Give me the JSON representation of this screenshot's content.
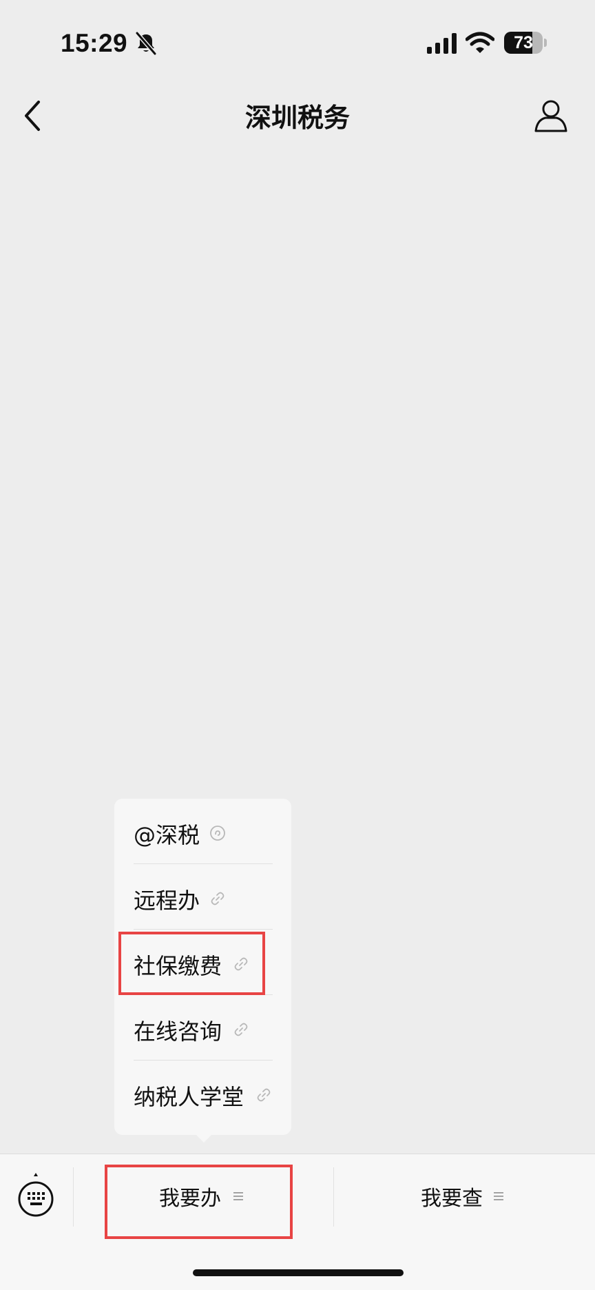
{
  "status_bar": {
    "time": "15:29",
    "battery_level": "73",
    "battery_fraction": 0.73,
    "icons": [
      "mute-bell-icon",
      "cellular-signal-icon",
      "wifi-icon",
      "battery-icon"
    ]
  },
  "nav": {
    "title": "深圳税务",
    "back_icon": "chevron-left-icon",
    "profile_icon": "person-icon"
  },
  "popup_menu": {
    "items": [
      {
        "label": "@深税",
        "icon": "mini-program-icon"
      },
      {
        "label": "远程办",
        "icon": "link-icon"
      },
      {
        "label": "社保缴费",
        "icon": "link-icon"
      },
      {
        "label": "在线咨询",
        "icon": "link-icon"
      },
      {
        "label": "纳税人学堂",
        "icon": "link-icon"
      }
    ]
  },
  "bottom_bar": {
    "keyboard_icon": "keyboard-icon",
    "menus": [
      {
        "label": "我要办",
        "icon": "menu-lines-icon"
      },
      {
        "label": "我要查",
        "icon": "menu-lines-icon"
      }
    ]
  },
  "colors": {
    "background": "#ededed",
    "panel": "#f7f7f7",
    "annotation_red": "#e84444"
  }
}
